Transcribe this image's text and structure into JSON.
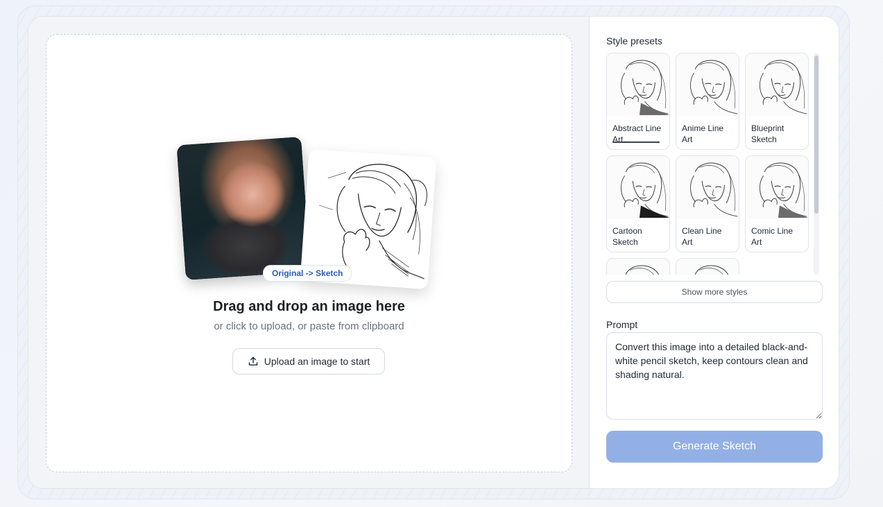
{
  "upload": {
    "badge": "Original -> Sketch",
    "title": "Drag and drop an image here",
    "subtitle": "or click to upload, or paste from clipboard",
    "button_label": "Upload an image to start",
    "button_icon": "upload-icon"
  },
  "presets": {
    "label": "Style presets",
    "items": [
      {
        "label": "Abstract Line Art...",
        "selected": true
      },
      {
        "label": "Anime Line Art"
      },
      {
        "label": "Blueprint Sketch"
      },
      {
        "label": "Cartoon Sketch"
      },
      {
        "label": "Clean Line Art"
      },
      {
        "label": "Comic Line Art"
      },
      {
        "label": ""
      },
      {
        "label": ""
      }
    ],
    "show_more_label": "Show more styles"
  },
  "prompt": {
    "label": "Prompt",
    "value": "Convert this image into a detailed black-and-white pencil sketch, keep contours clean and shading natural."
  },
  "generate": {
    "label": "Generate Sketch",
    "color": "#93b0e6"
  },
  "colors": {
    "accent_text": "#2a5bb8"
  }
}
